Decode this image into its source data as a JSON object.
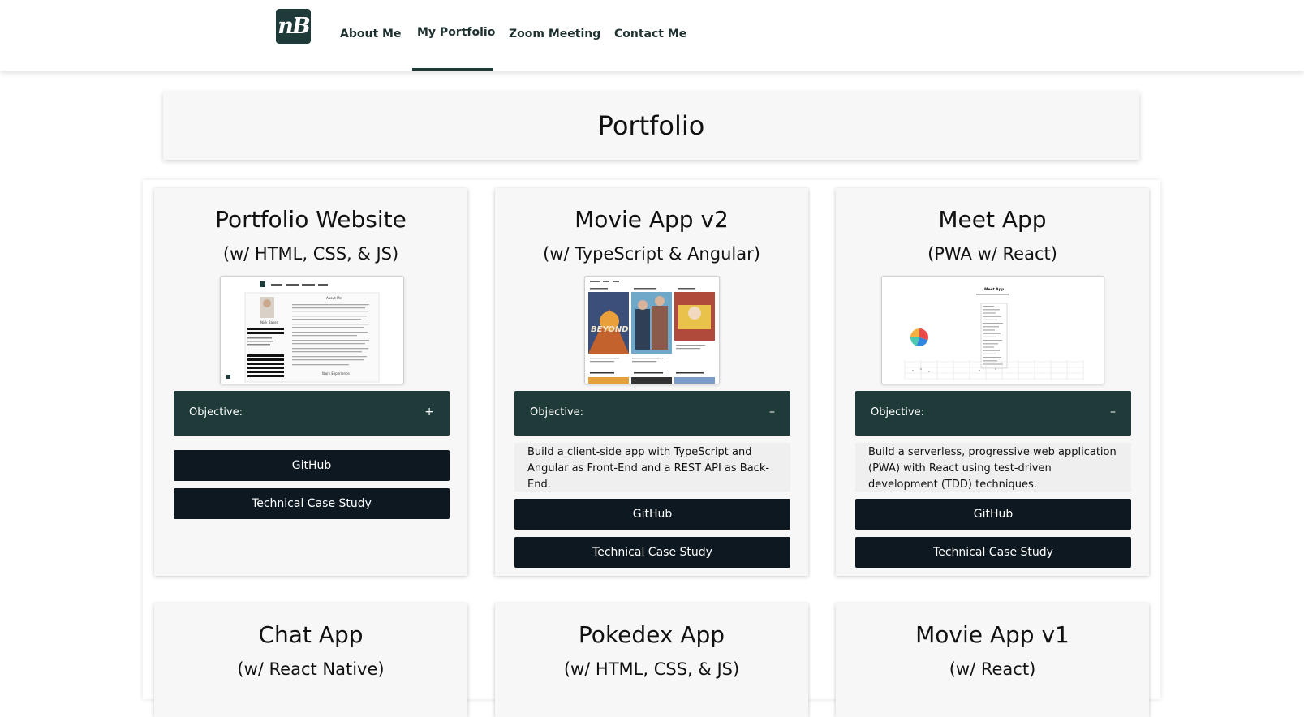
{
  "nav": {
    "logo_text": "nB",
    "links": [
      "About Me",
      "My Portfolio",
      "Zoom Meeting",
      "Contact Me"
    ],
    "active": "My Portfolio"
  },
  "page": {
    "title": "Portfolio"
  },
  "cards": [
    {
      "title": "Portfolio Website",
      "subtitle": "(w/ HTML, CSS, & JS)",
      "objective_label": "Objective:",
      "objective_toggle": "+",
      "objective_expanded": false,
      "objective_text": "",
      "github_label": "GitHub",
      "case_study_label": "Technical Case Study",
      "thumb_text": {
        "heading": "About Me",
        "name": "Nick Baker",
        "footer": "Work Experience"
      }
    },
    {
      "title": "Movie App v2",
      "subtitle": "(w/ TypeScript & Angular)",
      "objective_label": "Objective:",
      "objective_toggle": "–",
      "objective_expanded": true,
      "objective_text": "Build a client-side app with TypeScript and Angular as Front-End and a REST API as Back-End.",
      "github_label": "GitHub",
      "case_study_label": "Technical Case Study",
      "thumb_text": {
        "poster_text": "BEYOND"
      }
    },
    {
      "title": "Meet App",
      "subtitle": "(PWA w/ React)",
      "objective_label": "Objective:",
      "objective_toggle": "–",
      "objective_expanded": true,
      "objective_text": "Build a serverless, progressive web application (PWA) with React using test-driven development (TDD) techniques.",
      "github_label": "GitHub",
      "case_study_label": "Technical Case Study",
      "thumb_text": {
        "heading": "Meet App"
      }
    },
    {
      "title": "Chat App",
      "subtitle": "(w/ React Native)"
    },
    {
      "title": "Pokedex App",
      "subtitle": "(w/ HTML, CSS, & JS)"
    },
    {
      "title": "Movie App v1",
      "subtitle": "(w/ React)"
    }
  ],
  "colors": {
    "primary": "#1e3b3a",
    "button": "#0d1820",
    "card_bg": "#f7f7f7"
  },
  "chart_data": {
    "type": "pie",
    "labels": [],
    "values": [
      30,
      25,
      20,
      25
    ],
    "colors": [
      "#e94b4b",
      "#2e86de",
      "#48c9b0",
      "#f5b041"
    ]
  }
}
